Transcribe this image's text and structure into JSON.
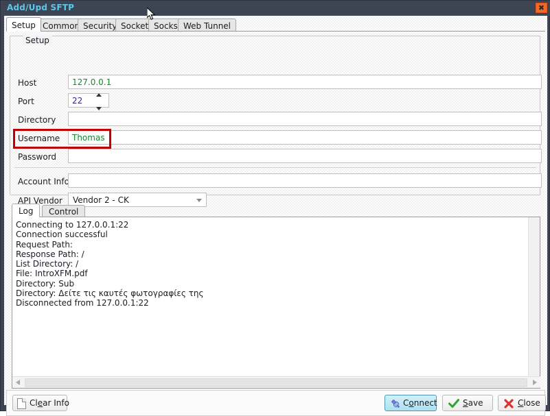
{
  "window": {
    "title": "Add/Upd SFTP",
    "title_color": "#5cc8e8",
    "frame_color": "#3d4453",
    "close_label": "✖",
    "close_color": "#f4682a"
  },
  "tabs": [
    {
      "label": "Setup",
      "active": true
    },
    {
      "label": "Common",
      "active": false
    },
    {
      "label": "Security",
      "active": false
    },
    {
      "label": "Socket",
      "active": false
    },
    {
      "label": "Socks",
      "active": false
    },
    {
      "label": "Web Tunnel",
      "active": false
    }
  ],
  "setup_group": {
    "legend": "Setup",
    "fields": {
      "host": {
        "label": "Host",
        "value": "127.0.0.1",
        "placeholder": ""
      },
      "port": {
        "label": "Port",
        "value": "22",
        "placeholder": ""
      },
      "directory": {
        "label": "Directory",
        "value": "",
        "placeholder": ""
      },
      "username": {
        "label": "Username",
        "value": "Thomas",
        "placeholder": "",
        "highlighted": true
      },
      "password": {
        "label": "Password",
        "value": "",
        "placeholder": ""
      },
      "account_info": {
        "label": "Account Info",
        "value": "",
        "placeholder": ""
      },
      "api_vendor": {
        "label": "API Vendor",
        "value": "Vendor 2 - CK"
      }
    },
    "value_colors": {
      "host": "#0f8a2e",
      "username": "#0f8a2e",
      "port": "#2a2a8a"
    },
    "highlight_color": "#c00000"
  },
  "log_tabs": [
    {
      "label": "Log",
      "active": true
    },
    {
      "label": "Control",
      "active": false
    }
  ],
  "log": {
    "lines": [
      "Connecting to 127.0.0.1:22",
      "Connection successful",
      "Request Path:",
      "Response Path: /",
      "List Directory: /",
      "File: IntroXFM.pdf",
      "Directory: Sub",
      "Directory: Δείτε τις καυτές φωτογραφίες της",
      "Disconnected from 127.0.0.1:22"
    ]
  },
  "footer": {
    "clear_info": {
      "label_pre": "Cl",
      "label_accel": "e",
      "label_post": "ar Info"
    },
    "connect": {
      "label_pre": "C",
      "label_accel": "o",
      "label_post": "nnect"
    },
    "save": {
      "label_pre": "",
      "label_accel": "S",
      "label_post": "ave"
    },
    "close": {
      "label_pre": "",
      "label_accel": "C",
      "label_post": "lose"
    },
    "save_icon_color": "#2aa62a",
    "close_icon_color": "#e03030",
    "connect_icon_color": "#4a5fc0"
  }
}
